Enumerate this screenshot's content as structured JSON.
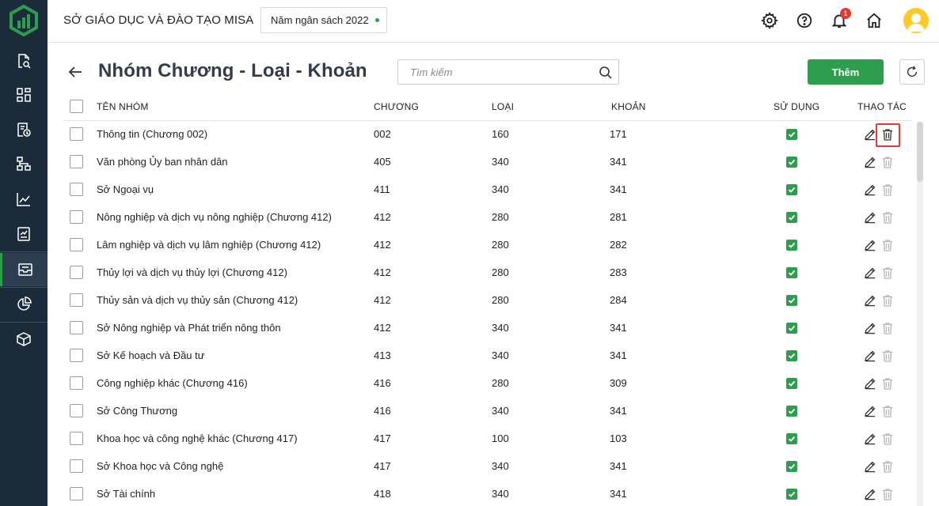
{
  "header": {
    "org_name": "SỞ GIÁO DỤC VÀ ĐÀO TẠO MISA",
    "fiscal_year": "Năm ngân sách 2022",
    "notification_count": "1"
  },
  "toolbar": {
    "title": "Nhóm Chương - Loại - Khoản",
    "search_placeholder": "Tìm kiếm",
    "add_label": "Thêm"
  },
  "table": {
    "columns": {
      "name": "TÊN NHÓM",
      "chuong": "CHƯƠNG",
      "loai": "LOẠI",
      "khoan": "KHOẢN",
      "su_dung": "SỬ DỤNG",
      "thao_tac": "THAO TÁC"
    },
    "rows": [
      {
        "name": "Thông tin (Chương 002)",
        "chuong": "002",
        "loai": "160",
        "khoan": "171"
      },
      {
        "name": "Văn phòng Ủy ban nhân dân",
        "chuong": "405",
        "loai": "340",
        "khoan": "341"
      },
      {
        "name": "Sở Ngoại vụ",
        "chuong": "411",
        "loai": "340",
        "khoan": "341"
      },
      {
        "name": "Nông nghiệp và dịch vụ nông nghiệp (Chương 412)",
        "chuong": "412",
        "loai": "280",
        "khoan": "281"
      },
      {
        "name": "Lâm nghiệp và dịch vụ lâm nghiệp (Chương 412)",
        "chuong": "412",
        "loai": "280",
        "khoan": "282"
      },
      {
        "name": "Thủy lợi và dịch vụ thủy lợi (Chương 412)",
        "chuong": "412",
        "loai": "280",
        "khoan": "283"
      },
      {
        "name": "Thủy sản và dịch vụ thủy sản (Chương 412)",
        "chuong": "412",
        "loai": "280",
        "khoan": "284"
      },
      {
        "name": "Sở Nông nghiệp và Phát triển nông thôn",
        "chuong": "412",
        "loai": "340",
        "khoan": "341"
      },
      {
        "name": "Sở Kế hoạch và Đầu tư",
        "chuong": "413",
        "loai": "340",
        "khoan": "341"
      },
      {
        "name": "Công nghiệp khác (Chương 416)",
        "chuong": "416",
        "loai": "280",
        "khoan": "309"
      },
      {
        "name": "Sở Công Thương",
        "chuong": "416",
        "loai": "340",
        "khoan": "341"
      },
      {
        "name": "Khoa học và công nghệ khác (Chương 417)",
        "chuong": "417",
        "loai": "100",
        "khoan": "103"
      },
      {
        "name": "Sở Khoa học và Công nghệ",
        "chuong": "417",
        "loai": "340",
        "khoan": "341"
      },
      {
        "name": "Sở Tài chính",
        "chuong": "418",
        "loai": "340",
        "khoan": "341"
      }
    ]
  },
  "colors": {
    "sidebar_bg": "#1c2b3a",
    "accent_green": "#2e9e4e",
    "highlight_red": "#e53935",
    "avatar_yellow": "#ffc928"
  },
  "icons": {
    "sidebar": [
      "search-document-icon",
      "dashboard-icon",
      "budget-icon",
      "hierarchy-icon",
      "chart-icon",
      "report-icon",
      "inbox-icon",
      "pie-chart-icon",
      "box-icon"
    ],
    "header": [
      "gear-icon",
      "help-icon",
      "bell-icon",
      "home-icon",
      "avatar"
    ]
  }
}
